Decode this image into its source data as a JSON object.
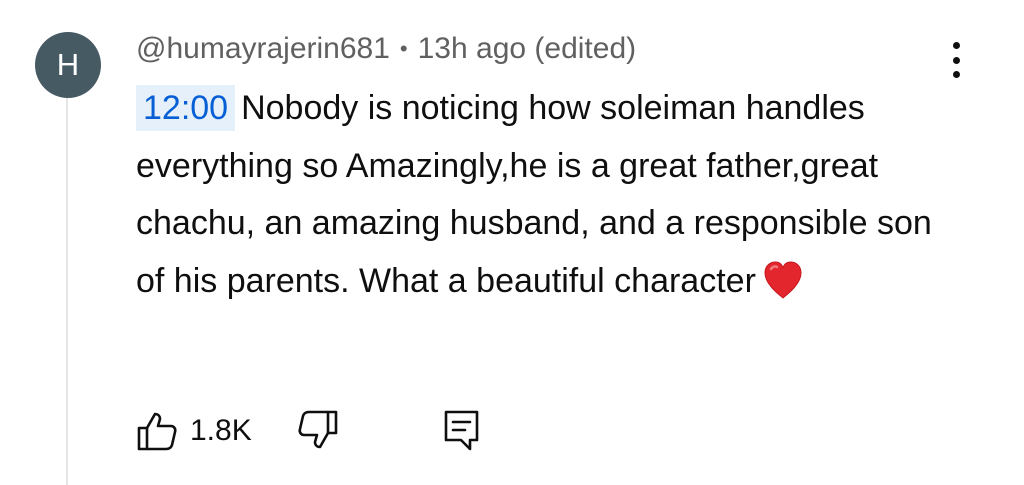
{
  "comment": {
    "avatar_letter": "H",
    "author": "@humayrajerin681",
    "separator": "•",
    "time": "13h ago (edited)",
    "timestamp_link": "12:00",
    "text": "Nobody is noticing how soleiman handles everything so Amazingly,he is a great father,great chachu, an amazing husband, and a responsible son of his parents. What a beautiful character",
    "emoji": "red-heart-emoji",
    "like_count": "1.8K",
    "avatar_color": "#465a64",
    "timestamp_color": "#065fd4",
    "timestamp_bg": "#e6f0fb"
  },
  "icons": {
    "menu": "more-vert-icon",
    "like": "thumb-up-icon",
    "dislike": "thumb-down-icon",
    "reply": "reply-comment-icon"
  }
}
